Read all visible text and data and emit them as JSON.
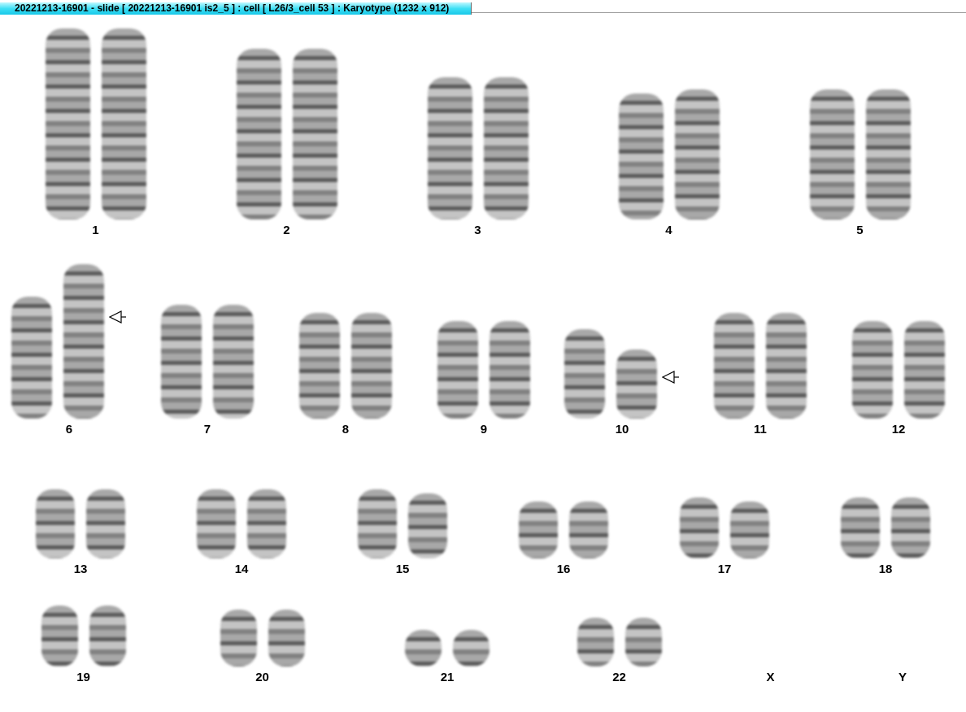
{
  "window": {
    "title": "20221213-16901 - slide [ 20221213-16901 is2_5 ] : cell [ L26/3_cell 53 ] : Karyotype  (1232 x 912)"
  },
  "karyotype": {
    "rows": [
      {
        "pairs": [
          {
            "label": "1",
            "chromosomes": [
              {
                "marked": false
              },
              {
                "marked": false
              }
            ]
          },
          {
            "label": "2",
            "chromosomes": [
              {
                "marked": false
              },
              {
                "marked": false
              }
            ]
          },
          {
            "label": "3",
            "chromosomes": [
              {
                "marked": false
              },
              {
                "marked": false
              }
            ]
          },
          {
            "label": "4",
            "chromosomes": [
              {
                "marked": false
              },
              {
                "marked": false
              }
            ]
          },
          {
            "label": "5",
            "chromosomes": [
              {
                "marked": false
              },
              {
                "marked": false
              }
            ]
          }
        ]
      },
      {
        "pairs": [
          {
            "label": "6",
            "chromosomes": [
              {
                "marked": false
              },
              {
                "marked": true
              }
            ]
          },
          {
            "label": "7",
            "chromosomes": [
              {
                "marked": false
              },
              {
                "marked": false
              }
            ]
          },
          {
            "label": "8",
            "chromosomes": [
              {
                "marked": false
              },
              {
                "marked": false
              }
            ]
          },
          {
            "label": "9",
            "chromosomes": [
              {
                "marked": false
              },
              {
                "marked": false
              }
            ]
          },
          {
            "label": "10",
            "chromosomes": [
              {
                "marked": false
              },
              {
                "marked": true
              }
            ]
          },
          {
            "label": "11",
            "chromosomes": [
              {
                "marked": false
              },
              {
                "marked": false
              }
            ]
          },
          {
            "label": "12",
            "chromosomes": [
              {
                "marked": false
              },
              {
                "marked": false
              }
            ]
          }
        ]
      },
      {
        "pairs": [
          {
            "label": "13",
            "chromosomes": [
              {
                "marked": false
              },
              {
                "marked": false
              }
            ]
          },
          {
            "label": "14",
            "chromosomes": [
              {
                "marked": false
              },
              {
                "marked": false
              }
            ]
          },
          {
            "label": "15",
            "chromosomes": [
              {
                "marked": false
              },
              {
                "marked": false
              }
            ]
          },
          {
            "label": "16",
            "chromosomes": [
              {
                "marked": false
              },
              {
                "marked": false
              }
            ]
          },
          {
            "label": "17",
            "chromosomes": [
              {
                "marked": false
              },
              {
                "marked": false
              }
            ]
          },
          {
            "label": "18",
            "chromosomes": [
              {
                "marked": false
              },
              {
                "marked": false
              }
            ]
          }
        ]
      },
      {
        "pairs": [
          {
            "label": "19",
            "chromosomes": [
              {
                "marked": false
              },
              {
                "marked": false
              }
            ]
          },
          {
            "label": "20",
            "chromosomes": [
              {
                "marked": false
              },
              {
                "marked": false
              }
            ]
          },
          {
            "label": "21",
            "chromosomes": [
              {
                "marked": false
              },
              {
                "marked": false
              }
            ]
          },
          {
            "label": "22",
            "chromosomes": [
              {
                "marked": false
              },
              {
                "marked": false
              }
            ]
          },
          {
            "label": "X"
          },
          {
            "label": "Y"
          }
        ]
      }
    ]
  }
}
